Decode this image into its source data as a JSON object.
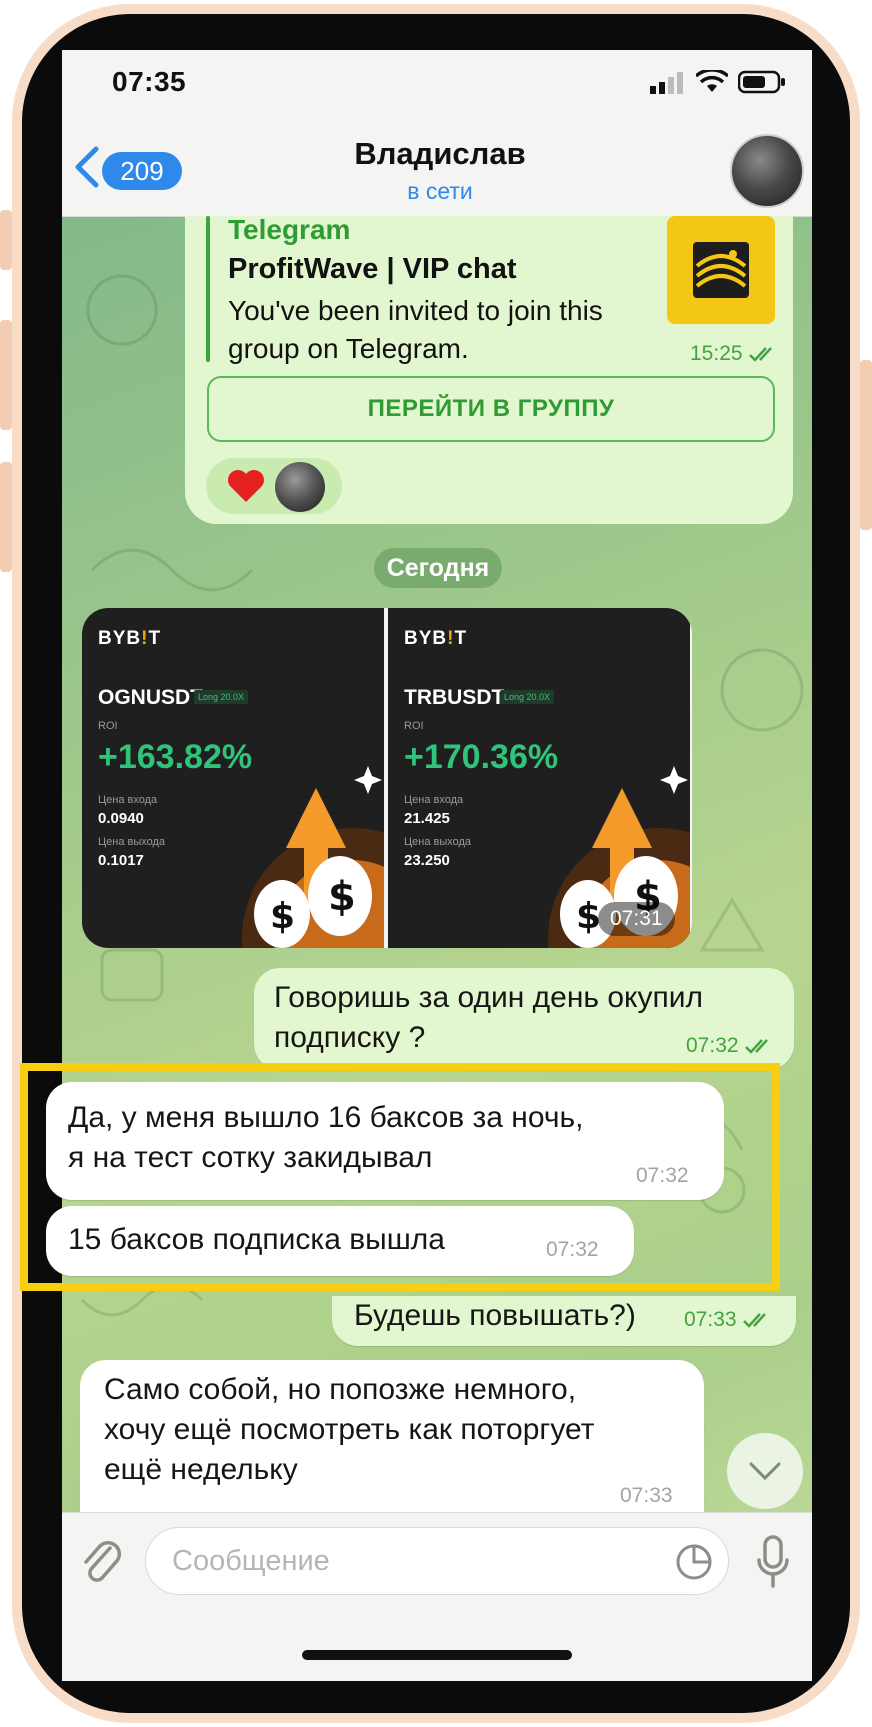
{
  "status_bar": {
    "time": "07:35"
  },
  "header": {
    "back_badge": "209",
    "contact_name": "Владислав",
    "contact_status": "в сети"
  },
  "invite": {
    "site": "Telegram",
    "title": "ProfitWave | VIP chat",
    "description": "You've been invited to join this group on Telegram.",
    "time": "15:25",
    "button_label": "ПЕРЕЙТИ В ГРУППУ"
  },
  "date_separator": "Сегодня",
  "trade_cards": {
    "time": "07:31",
    "items": [
      {
        "brand": "BYB",
        "brand_i": "!",
        "brand_end": "T",
        "pair": "OGNUSDT",
        "tag": "Long 20.0X",
        "roi_label": "ROI",
        "roi": "+163.82%",
        "entry_label": "Цена входа",
        "entry": "0.0940",
        "exit_label": "Цена выхода",
        "exit": "0.1017"
      },
      {
        "brand": "BYB",
        "brand_i": "!",
        "brand_end": "T",
        "pair": "TRBUSDT",
        "tag": "Long 20.0X",
        "roi_label": "ROI",
        "roi": "+170.36%",
        "entry_label": "Цена входа",
        "entry": "21.425",
        "exit_label": "Цена выхода",
        "exit": "23.250"
      }
    ]
  },
  "messages": [
    {
      "dir": "out",
      "lines": [
        "Говоришь за один день окупил",
        "подписку ?"
      ],
      "time": "07:32"
    },
    {
      "dir": "in",
      "lines": [
        "Да, у меня вышло 16 баксов за ночь,",
        "я на тест сотку закидывал"
      ],
      "time": "07:32"
    },
    {
      "dir": "in",
      "lines": [
        "15 баксов подписка вышла"
      ],
      "time": "07:32"
    },
    {
      "dir": "out",
      "lines": [
        "Будешь повышать?)"
      ],
      "time": "07:33"
    },
    {
      "dir": "in",
      "lines": [
        "Само собой, но попозже немного,",
        "хочу ещё посмотреть как поторгует",
        "ещё недельку"
      ],
      "time": "07:33"
    }
  ],
  "composer": {
    "placeholder": "Сообщение"
  },
  "colors": {
    "accent_blue": "#2f89ea",
    "outgoing_bubble": "#e2f6cf",
    "highlight": "#f7cf10"
  }
}
